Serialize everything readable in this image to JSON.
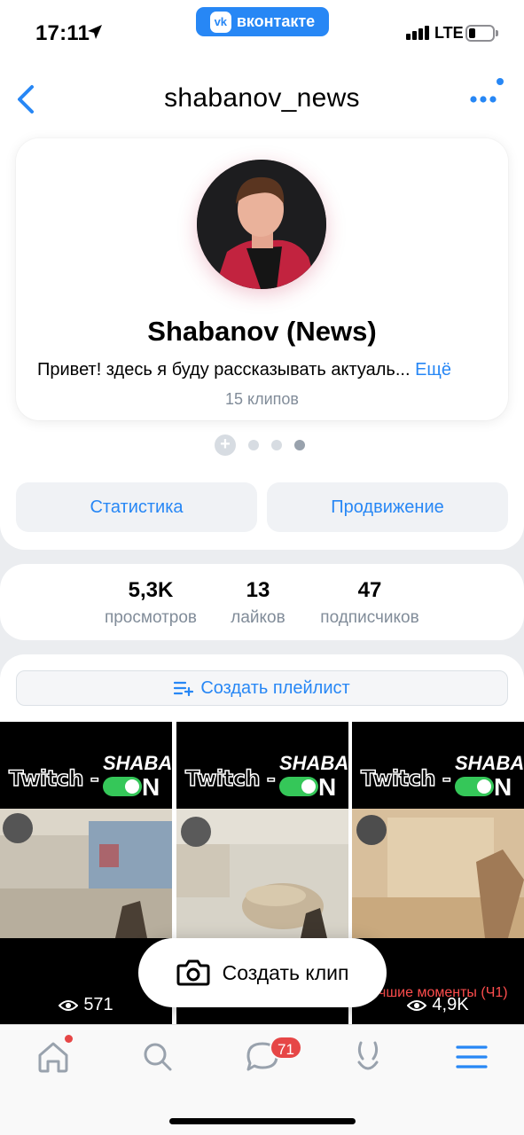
{
  "status_bar": {
    "time": "17:11",
    "network": "LTE",
    "app_badge": "вконтакте",
    "app_badge_logo": "vk"
  },
  "header": {
    "title": "shabanov_news",
    "back_icon": "chevron-left-icon",
    "more_icon": "more-horizontal-icon"
  },
  "profile": {
    "name": "Shabanov (News)",
    "bio": "Привет! здесь я буду рассказывать актуаль...",
    "bio_more": "Ещё",
    "clips_count": "15 клипов",
    "plus": "+"
  },
  "actions": {
    "stats_label": "Статистика",
    "promo_label": "Продвижение"
  },
  "stats": [
    {
      "value": "5,3K",
      "label": "просмотров"
    },
    {
      "value": "13",
      "label": "лайков"
    },
    {
      "value": "47",
      "label": "подписчиков"
    }
  ],
  "playlist": {
    "label": "Создать плейлист",
    "icon": "playlist-add-icon"
  },
  "clips": [
    {
      "views": "571",
      "title_text": "Twitch -",
      "brand_top": "SHABA",
      "brand_bottom": "N",
      "caption": ""
    },
    {
      "views": "",
      "title_text": "Twitch -",
      "brand_top": "SHABA",
      "brand_bottom": "N",
      "caption": ""
    },
    {
      "views": "4,9K",
      "title_text": "Twitch -",
      "brand_top": "SHABA",
      "brand_bottom": "N",
      "caption": "чшие моменты (Ч1)"
    }
  ],
  "create_clip": {
    "label": "Создать клип",
    "icon": "camera-icon"
  },
  "tabs": {
    "messages_badge": "71"
  },
  "colors": {
    "accent": "#2787f5",
    "badge": "#e64646",
    "toggle_on": "#35c759"
  }
}
